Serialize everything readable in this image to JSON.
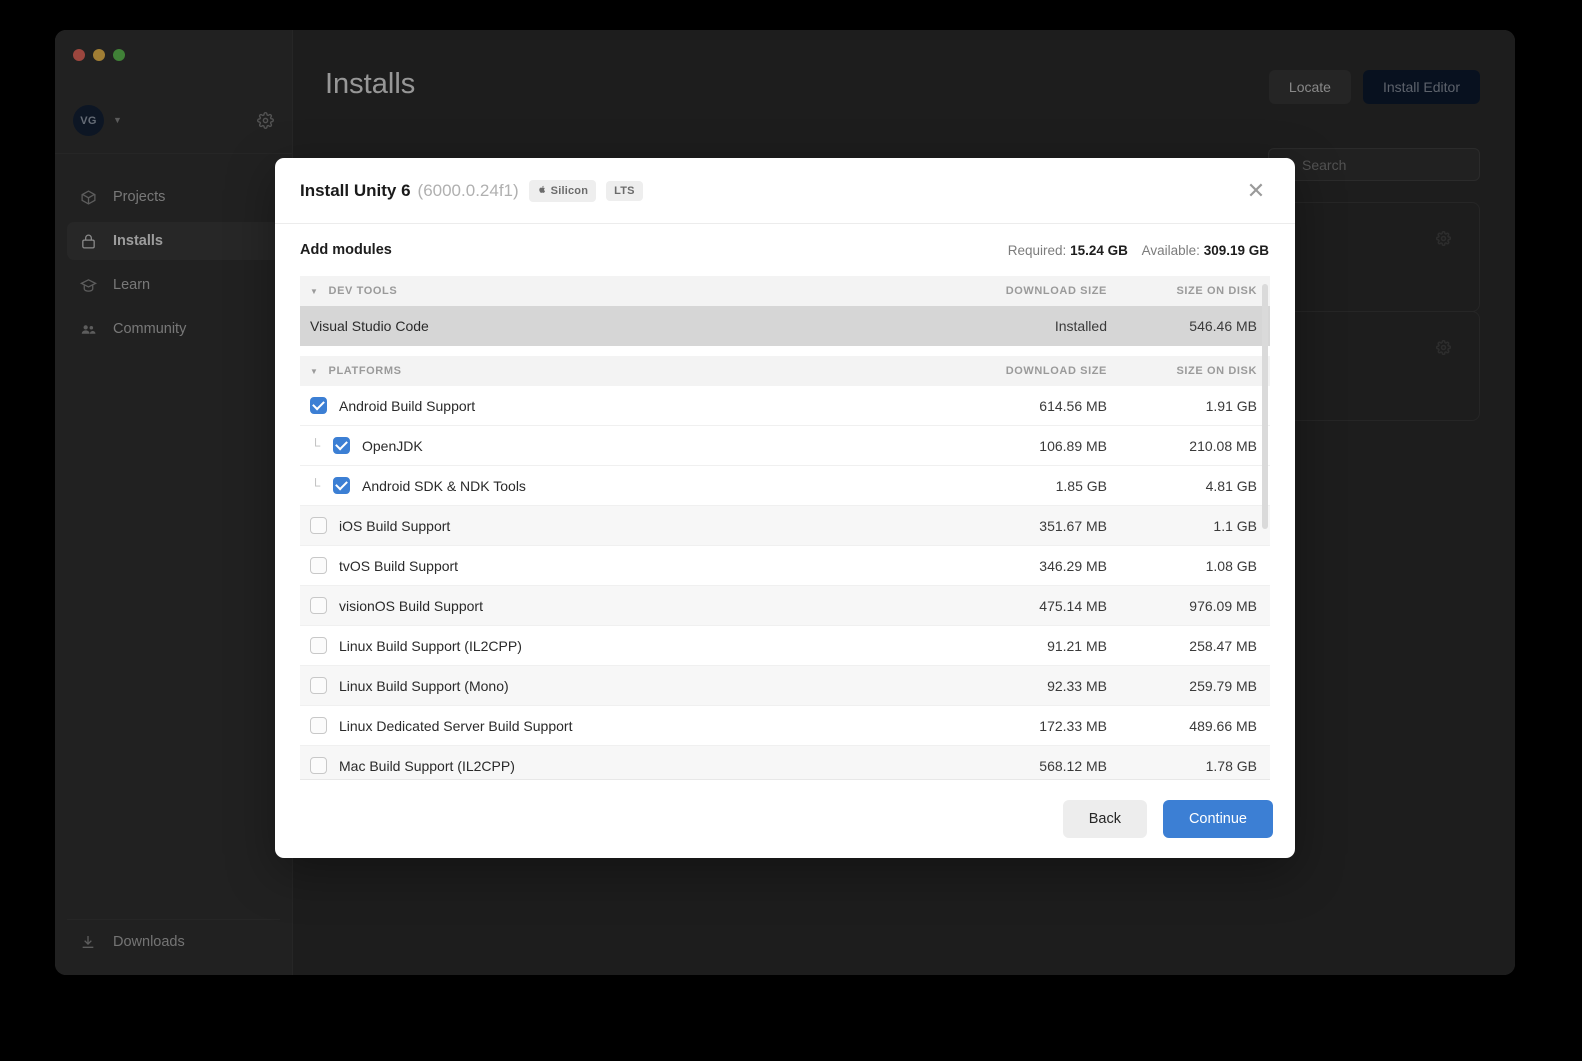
{
  "app": {
    "title": "Installs",
    "account_initials": "VG",
    "nav_items": [
      {
        "label": "Projects",
        "icon": "cube-icon",
        "active": false
      },
      {
        "label": "Installs",
        "icon": "lock-icon",
        "active": true
      },
      {
        "label": "Learn",
        "icon": "graduation-cap-icon",
        "active": false
      },
      {
        "label": "Community",
        "icon": "people-icon",
        "active": false
      }
    ],
    "downloads_label": "Downloads",
    "locate_label": "Locate",
    "install_editor_label": "Install Editor",
    "search_placeholder": "Search",
    "accent_color": "#3c7fd4",
    "install_editor_bg": "#0d1b30"
  },
  "dialog": {
    "title": "Install Unity 6",
    "version": "(6000.0.24f1)",
    "chips": [
      {
        "label": "Silicon",
        "icon": "apple-icon"
      },
      {
        "label": "LTS",
        "icon": ""
      }
    ],
    "close_icon": "close-icon",
    "section_label": "Add modules",
    "capacity": {
      "required_label": "Required:",
      "required_value": "15.24 GB",
      "available_label": "Available:",
      "available_value": "309.19 GB"
    },
    "columns": {
      "download_size": "DOWNLOAD SIZE",
      "size_on_disk": "SIZE ON DISK"
    },
    "groups": [
      {
        "name": "DEV TOOLS",
        "expanded": true,
        "rows": [
          {
            "label": "Visual Studio Code",
            "download_size": "Installed",
            "size_on_disk": "546.46 MB",
            "checkbox": "none",
            "indent": 0,
            "selected": true
          }
        ]
      },
      {
        "name": "PLATFORMS",
        "expanded": true,
        "rows": [
          {
            "label": "Android Build Support",
            "download_size": "614.56 MB",
            "size_on_disk": "1.91 GB",
            "checkbox": "checked",
            "indent": 0,
            "selected": false
          },
          {
            "label": "OpenJDK",
            "download_size": "106.89 MB",
            "size_on_disk": "210.08 MB",
            "checkbox": "checked",
            "indent": 1,
            "selected": false
          },
          {
            "label": "Android SDK & NDK Tools",
            "download_size": "1.85 GB",
            "size_on_disk": "4.81 GB",
            "checkbox": "checked",
            "indent": 1,
            "selected": false
          },
          {
            "label": "iOS Build Support",
            "download_size": "351.67 MB",
            "size_on_disk": "1.1 GB",
            "checkbox": "unchecked",
            "indent": 0,
            "selected": false
          },
          {
            "label": "tvOS Build Support",
            "download_size": "346.29 MB",
            "size_on_disk": "1.08 GB",
            "checkbox": "unchecked",
            "indent": 0,
            "selected": false
          },
          {
            "label": "visionOS Build Support",
            "download_size": "475.14 MB",
            "size_on_disk": "976.09 MB",
            "checkbox": "unchecked",
            "indent": 0,
            "selected": false
          },
          {
            "label": "Linux Build Support (IL2CPP)",
            "download_size": "91.21 MB",
            "size_on_disk": "258.47 MB",
            "checkbox": "unchecked",
            "indent": 0,
            "selected": false
          },
          {
            "label": "Linux Build Support (Mono)",
            "download_size": "92.33 MB",
            "size_on_disk": "259.79 MB",
            "checkbox": "unchecked",
            "indent": 0,
            "selected": false
          },
          {
            "label": "Linux Dedicated Server Build Support",
            "download_size": "172.33 MB",
            "size_on_disk": "489.66 MB",
            "checkbox": "unchecked",
            "indent": 0,
            "selected": false
          },
          {
            "label": "Mac Build Support (IL2CPP)",
            "download_size": "568.12 MB",
            "size_on_disk": "1.78 GB",
            "checkbox": "unchecked",
            "indent": 0,
            "selected": false
          }
        ]
      }
    ],
    "back_label": "Back",
    "continue_label": "Continue"
  }
}
